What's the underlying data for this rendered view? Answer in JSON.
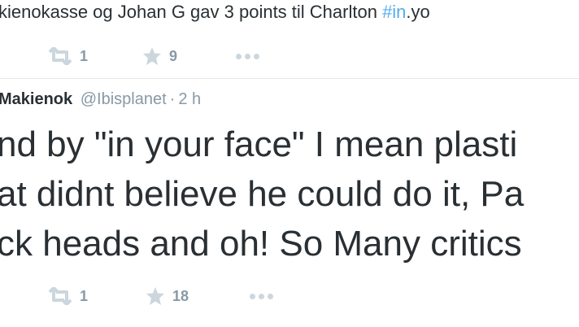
{
  "top_tweet": {
    "text": "kienokasse og Johan G gav 3 points til Charlton ",
    "hashtag": "#in",
    "text_after": ".yo",
    "retweet_count": "1",
    "favorite_count": "9"
  },
  "main_tweet": {
    "author_name": "Makienok",
    "handle": "@Ibisplanet",
    "separator": "·",
    "time": "2 h",
    "lines": [
      "nd by \"in your face\" I mean plasti",
      "at didnt believe he could do it, Pa",
      "ck heads and oh! So Many critics"
    ],
    "retweet_count": "1",
    "favorite_count": "18"
  },
  "icons": {
    "retweet": "retweet-icon",
    "favorite": "star-icon",
    "more": "more-dots-icon"
  },
  "colors": {
    "text": "#292f33",
    "muted": "#8899a6",
    "icon": "#ccd6dd",
    "link": "#55acee"
  }
}
